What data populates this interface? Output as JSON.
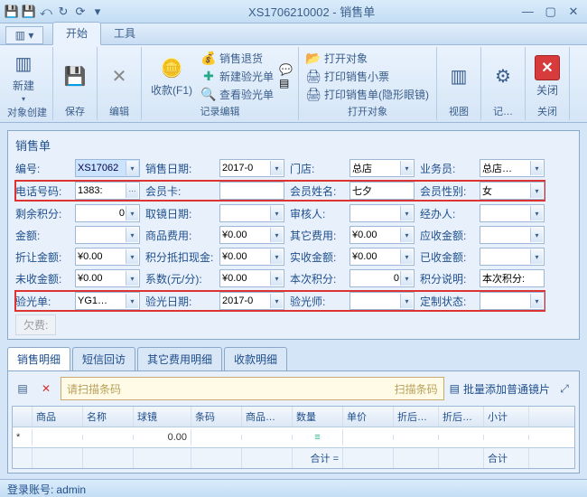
{
  "window": {
    "title": "XS1706210002 - 销售单"
  },
  "menu": {
    "start": "开始",
    "tools": "工具"
  },
  "ribbon": {
    "g1": {
      "new": "新建",
      "label": "对象创建"
    },
    "g2": {
      "label": "保存"
    },
    "g3": {
      "label": "编辑"
    },
    "g4": {
      "collect": "收款(F1)",
      "return": "销售退货",
      "newyg": "新建验光单",
      "viewyg": "查看验光单",
      "label": "记录编辑"
    },
    "g5": {
      "openobj": "打开对象",
      "printtkt": "打印销售小票",
      "printhidden": "打印销售单(隐形眼镜)",
      "label": "打开对象"
    },
    "g6": {
      "label": "视图"
    },
    "g7": {
      "label": "记…"
    },
    "g8": {
      "close": "关闭",
      "label": "关闭"
    }
  },
  "form": {
    "title": "销售单",
    "labels": {
      "id": "编号:",
      "date": "销售日期:",
      "store": "门店:",
      "sales": "业务员:",
      "phone": "电话号码:",
      "card": "会员卡:",
      "mname": "会员姓名:",
      "gender": "会员性别:",
      "points": "剩余积分:",
      "pickdate": "取镜日期:",
      "auditor": "审核人:",
      "handler": "经办人:",
      "amount": "金额:",
      "goodsfee": "商品费用:",
      "otherfee": "其它费用:",
      "receivable": "应收金额:",
      "discount": "折让金额:",
      "pointcash": "积分抵扣现金:",
      "actual": "实收金额:",
      "received": "已收金额:",
      "unreceived": "未收金额:",
      "coef": "系数(元/分):",
      "thispoints": "本次积分:",
      "pointnote": "积分说明:",
      "ygid": "验光单:",
      "ygdate": "验光日期:",
      "ygperson": "验光师:",
      "custom": "定制状态:"
    },
    "values": {
      "id": "XS17062",
      "date": "2017-0",
      "store": "总店",
      "sales": "总店…",
      "phone": "1383:",
      "card": "",
      "mname": "七夕",
      "gender": "女",
      "points": "0",
      "pickdate": "",
      "auditor": "",
      "handler": "",
      "amount": "",
      "goodsfee": "¥0.00",
      "otherfee": "¥0.00",
      "receivable": "",
      "discount": "¥0.00",
      "pointcash": "¥0.00",
      "actual": "¥0.00",
      "received": "",
      "unreceived": "¥0.00",
      "coef": "¥0.00",
      "thispoints": "0",
      "pointnote": "本次积分:",
      "ygid": "YG1…",
      "ygdate": "2017-0",
      "ygperson": "",
      "custom": ""
    },
    "arrears": "欠费:"
  },
  "tabs": {
    "detail": "销售明细",
    "sms": "短信回访",
    "other": "其它费用明细",
    "pay": "收款明细"
  },
  "detail": {
    "scan_placeholder": "请扫描条码",
    "scan_right": "扫描条码",
    "batch": "批量添加普通镜片",
    "cols": [
      "",
      "商品",
      "名称",
      "球镜",
      "条码",
      "商品…",
      "数量",
      "单价",
      "折后…",
      "折后…",
      "小计"
    ],
    "row": {
      "qj": "0.00",
      "qty_icon": "≡"
    },
    "sum_label": "合计 =",
    "sum_right": "合计"
  },
  "status": {
    "login_label": "登录账号:",
    "login_user": "admin"
  }
}
